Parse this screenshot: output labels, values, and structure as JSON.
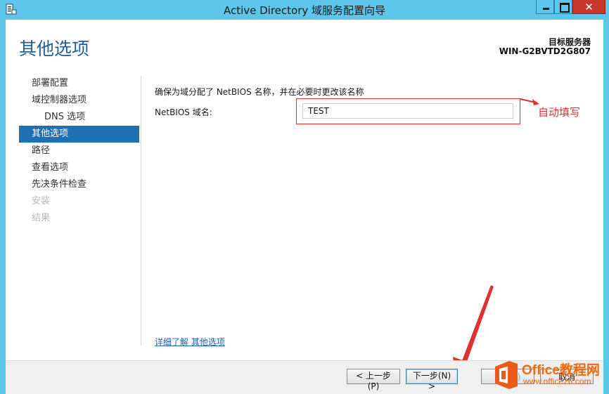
{
  "window": {
    "title": "Active Directory 域服务配置向导",
    "close_glyph": "✕"
  },
  "header": {
    "page_title": "其他选项",
    "target_server_label": "目标服务器",
    "target_server_name": "WIN-G2BVTD2G807"
  },
  "nav": {
    "items": [
      {
        "label": "部署配置"
      },
      {
        "label": "域控制器选项"
      },
      {
        "label": "DNS 选项"
      },
      {
        "label": "其他选项"
      },
      {
        "label": "路径"
      },
      {
        "label": "查看选项"
      },
      {
        "label": "先决条件检查"
      },
      {
        "label": "安装"
      },
      {
        "label": "结果"
      }
    ]
  },
  "main": {
    "instruction": "确保为域分配了 NetBIOS 名称，并在必要时更改该名称",
    "netbios_label": "NetBIOS 域名:",
    "netbios_value": "TEST",
    "annotation": "自动填写",
    "more_link": "详细了解 其他选项"
  },
  "footer": {
    "prev_label": "< 上一步(P)",
    "next_label": "下一步(N) >",
    "install_label": "安装(I)",
    "cancel_label": "取消"
  },
  "watermark": {
    "brand": "Office教程网",
    "url": "www.office26.com"
  },
  "colors": {
    "titlebar": "#5ec5eb",
    "accent": "#1f6fb3",
    "annotation_red": "#e03030",
    "close_red": "#c7392c",
    "watermark_orange": "#f06a0a"
  }
}
